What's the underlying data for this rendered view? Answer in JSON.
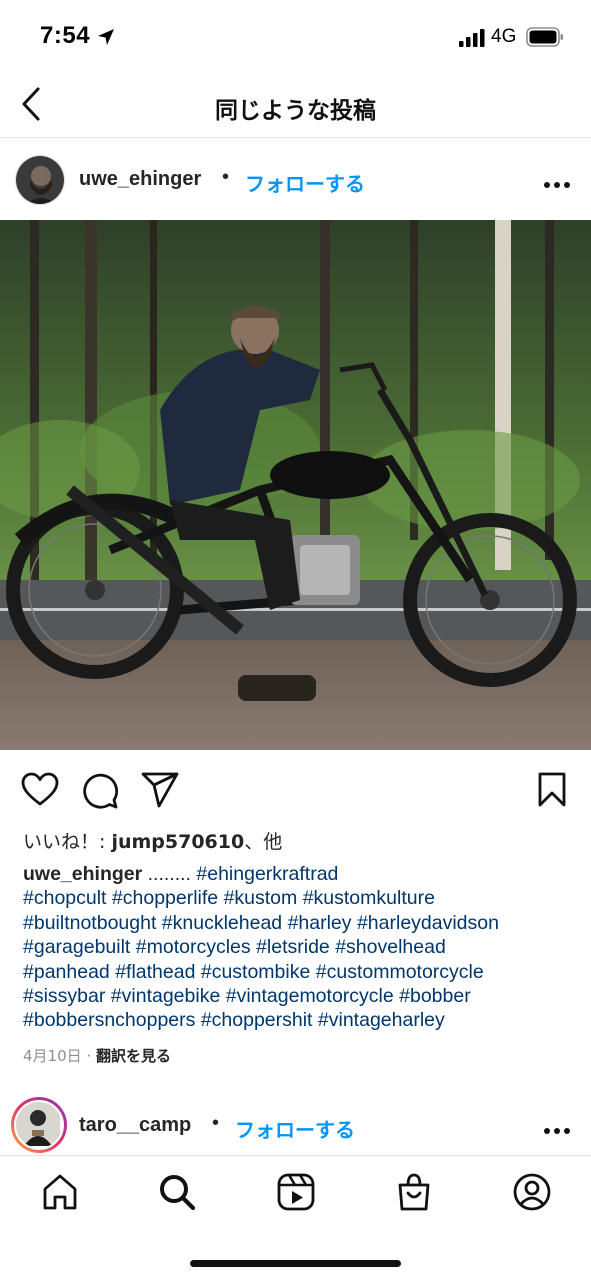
{
  "status": {
    "time": "7:54",
    "network": "4G"
  },
  "header": {
    "title": "同じような投稿"
  },
  "post": {
    "username": "uwe_ehinger",
    "dot": "•",
    "follow_label": "フォローする",
    "likes_prefix": "いいね！: ",
    "likes_user": "jump570610",
    "likes_suffix": "、他",
    "caption_user": "uwe_ehinger",
    "caption_ellipsis": " ........ ",
    "hashtags": [
      "#ehingerkraftrad",
      "#chopcult",
      "#chopperlife",
      "#kustom",
      "#kustomkulture",
      "#builtnotbought",
      "#knucklehead",
      "#harley",
      "#harleydavidson",
      "#garagebuilt",
      "#motorcycles",
      " #letsride",
      "#shovelhead",
      "#panhead",
      "#flathead",
      " #custombike",
      "#custommotorcycle",
      "#sissybar",
      "#vintagebike",
      "#vintagemotorcycle",
      "#bobber",
      "#bobbersnchoppers",
      "#choppershit",
      "#vintageharley"
    ],
    "date": "4月10日",
    "meta_dot": "·",
    "translate_label": "翻訳を見る"
  },
  "next_post": {
    "username": "taro__camp",
    "dot": "•",
    "follow_label": "フォローする"
  },
  "icons": {
    "back": "chevron-left-icon",
    "more": "more-horizontal-icon",
    "like": "heart-icon",
    "comment": "comment-icon",
    "share": "paper-plane-icon",
    "save": "bookmark-icon",
    "tabs": [
      "home-icon",
      "search-icon",
      "reels-icon",
      "shop-icon",
      "profile-icon"
    ]
  },
  "colors": {
    "link_blue": "#0095f6",
    "hashtag": "#00376b",
    "meta_gray": "#8e8e8e"
  }
}
